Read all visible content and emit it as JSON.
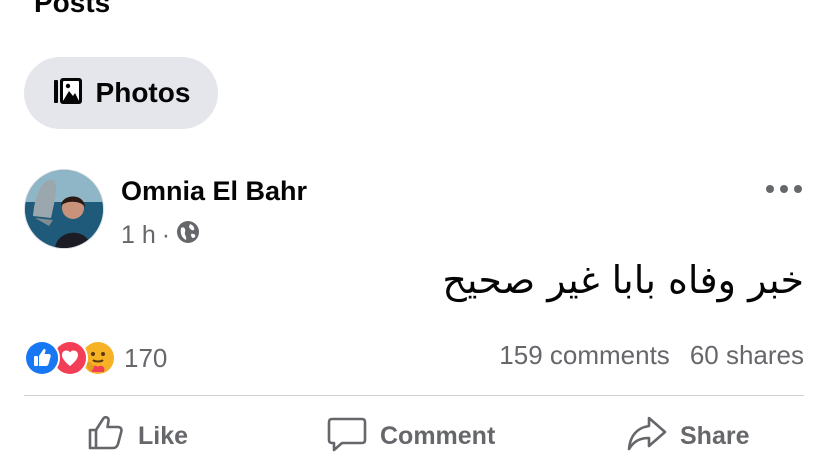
{
  "section": {
    "title": "Posts"
  },
  "filter_chip": {
    "label": "Photos",
    "icon": "photos-icon"
  },
  "post": {
    "author": "Omnia El Bahr",
    "time": "1 h",
    "separator": "·",
    "privacy_icon": "globe-icon",
    "text": "خبر وفاه بابا غير صحيح",
    "reactions": {
      "icons": [
        "like-reaction-icon",
        "love-reaction-icon",
        "care-reaction-icon"
      ],
      "count": "170"
    },
    "comments": "159 comments",
    "shares": "60 shares"
  },
  "actions": {
    "like": "Like",
    "comment": "Comment",
    "share": "Share"
  },
  "colors": {
    "like_blue": "#1877f2",
    "love_red": "#f33e58",
    "care_yellow": "#f7b125",
    "secondary_text": "#65676b",
    "chip_bg": "#e4e6eb"
  }
}
